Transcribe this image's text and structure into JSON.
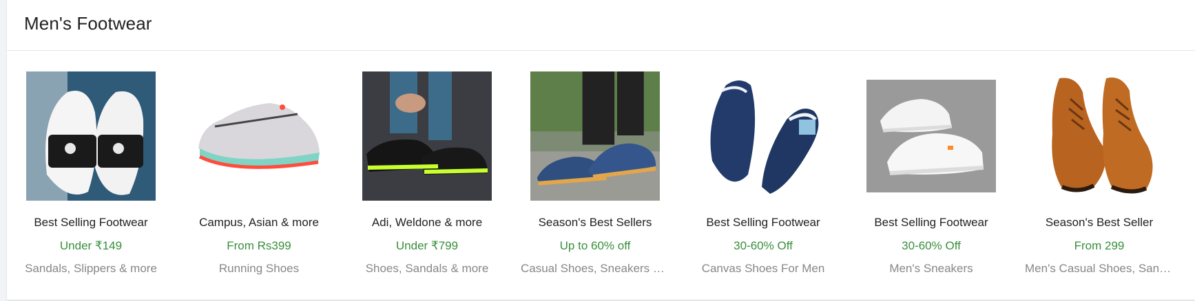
{
  "section": {
    "title": "Men's Footwear"
  },
  "tiles": [
    {
      "name": "Best Selling Footwear",
      "offer": "Under ₹149",
      "subtitle": "Sandals, Slippers & more",
      "image": "slider-sandals-image"
    },
    {
      "name": "Campus, Asian & more",
      "offer": "From Rs399",
      "subtitle": "Running Shoes",
      "image": "running-shoe-image"
    },
    {
      "name": "Adi, Weldone & more",
      "offer": "Under ₹799",
      "subtitle": "Shoes, Sandals & more",
      "image": "sport-shoes-image"
    },
    {
      "name": "Season's Best Sellers",
      "offer": "Up to 60% off",
      "subtitle": "Casual Shoes, Sneakers & more",
      "image": "casual-shoes-image"
    },
    {
      "name": "Best Selling Footwear",
      "offer": "30-60% Off",
      "subtitle": "Canvas Shoes For Men",
      "image": "canvas-loafers-image"
    },
    {
      "name": "Best Selling Footwear",
      "offer": "30-60% Off",
      "subtitle": "Men's Sneakers",
      "image": "white-sneakers-image"
    },
    {
      "name": "Season's Best Seller",
      "offer": "From 299",
      "subtitle": "Men's Casual Shoes, Sandals & more",
      "image": "brown-boots-image"
    }
  ],
  "colors": {
    "offer_green": "#388e3c",
    "subtitle_gray": "#878787",
    "title_black": "#212121"
  }
}
